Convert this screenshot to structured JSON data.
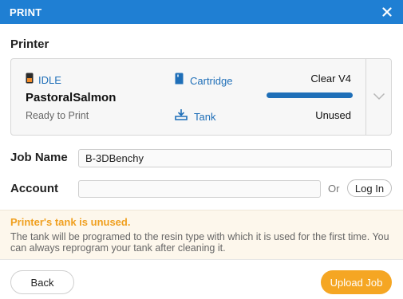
{
  "window": {
    "title": "PRINT"
  },
  "printer_section": {
    "label": "Printer"
  },
  "printer": {
    "status": "IDLE",
    "name": "PastoralSalmon",
    "subtitle": "Ready to Print",
    "cartridge_label": "Cartridge",
    "cartridge_value": "Clear V4",
    "cartridge_level_fraction": 1.0,
    "tank_label": "Tank",
    "tank_value": "Unused"
  },
  "job": {
    "label": "Job Name",
    "value": "B-3DBenchy"
  },
  "account": {
    "label": "Account",
    "value": "",
    "or_text": "Or",
    "login_label": "Log In"
  },
  "notice": {
    "title": "Printer's tank is unused.",
    "body": "The tank will be programed to the resin type with which it is used for the first time. You can always reprogram your tank after cleaning it."
  },
  "footer": {
    "back_label": "Back",
    "upload_label": "Upload Job"
  },
  "colors": {
    "title_bar": "#1f7fd3",
    "link": "#1f6fb8",
    "accent_orange": "#f5a623",
    "notice_title": "#f0a020"
  },
  "icons": {
    "status": "printer-status-icon",
    "cartridge": "cartridge-icon",
    "tank": "tank-icon",
    "close": "close-icon",
    "dropdown": "chevron-down-icon"
  }
}
